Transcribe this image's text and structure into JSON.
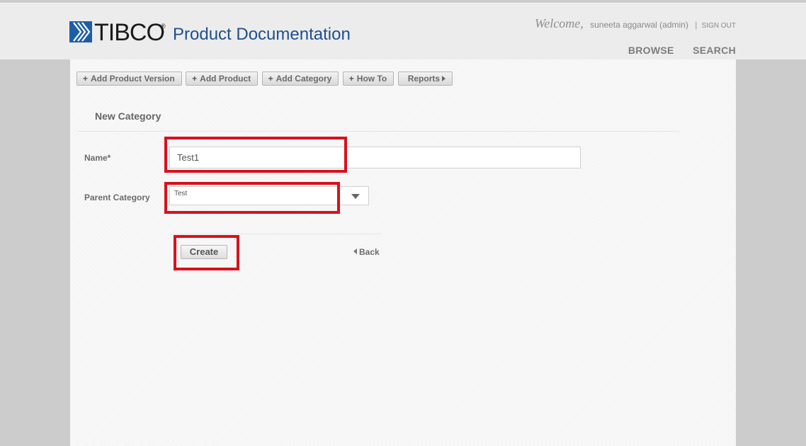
{
  "header": {
    "logo_text": "TIBCO",
    "logo_registered": "®",
    "product_title": "Product Documentation",
    "welcome_greeting": "Welcome,",
    "user_display": "suneeta aggarwal (admin)",
    "separator": "|",
    "sign_out_label": "SIGN OUT",
    "nav": {
      "browse": "BROWSE",
      "search": "SEARCH"
    }
  },
  "toolbar": {
    "add_product_version": "Add Product Version",
    "add_product": "Add Product",
    "add_category": "Add Category",
    "how_to": "How To",
    "reports": "Reports"
  },
  "form": {
    "title": "New Category",
    "name_label": "Name*",
    "name_value": "Test1",
    "parent_label": "Parent Category",
    "parent_value": "Test",
    "create_label": "Create",
    "back_label": "Back"
  },
  "colors": {
    "brand_blue": "#1f4f8a",
    "highlight_red": "#d8111e",
    "page_gray": "#cccccc"
  }
}
